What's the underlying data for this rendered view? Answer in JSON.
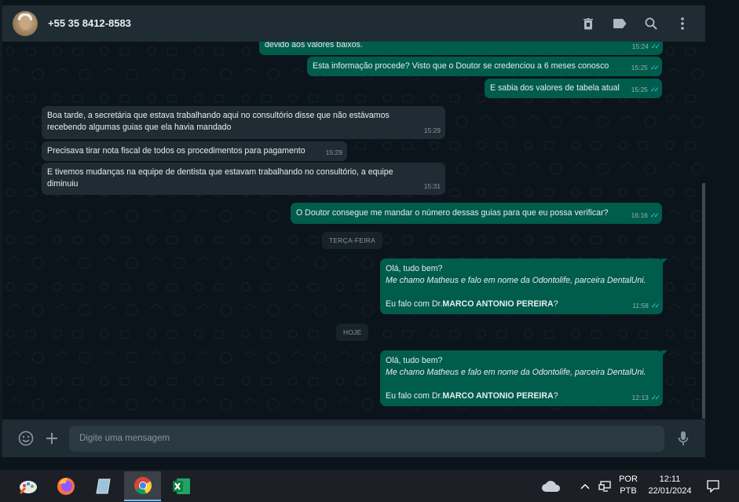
{
  "header": {
    "contact_name": "+55 35 8412-8583",
    "icons": [
      "delete-icon",
      "label-icon",
      "search-icon",
      "menu-icon"
    ]
  },
  "messages": {
    "m1": {
      "text": "devido aos valores baixos.",
      "time": "15:24"
    },
    "m2": {
      "text": "Esta informação procede? Visto que o Doutor se credenciou a 6 meses conosco",
      "time": "15:25"
    },
    "m3": {
      "text": "E sabia dos valores de tabela atual",
      "time": "15:25"
    },
    "m4": {
      "line1": "Boa tarde, a secretária que estava trabalhando aqui no consultório disse que não estávamos",
      "line2": "recebendo algumas guias que ela havia mandado",
      "time": "15:29"
    },
    "m5": {
      "text": "Precisava tirar nota fiscal de todos os procedimentos para pagamento",
      "time": "15:29"
    },
    "m6": {
      "line1": "E tivemos mudanças na equipe de dentista que estavam trabalhando no consultório, a equipe",
      "line2": "diminuiu",
      "time": "15:31"
    },
    "m7": {
      "text": "O Doutor consegue me mandar o número dessas guias para que eu possa verificar?",
      "time": "16:16"
    },
    "date1": "TERÇA-FEIRA",
    "m8": {
      "line1": "Olá, tudo bem?",
      "line2": "Me chamo Matheus e falo em nome da Odontolife, parceira DentalUni.",
      "line3_prefix": "Eu falo com Dr.",
      "line3_name": "MARCO ANTONIO PEREIRA",
      "line3_suffix": "?",
      "time": "11:58"
    },
    "date2": "HOJE",
    "m9": {
      "line1": "Olá, tudo bem?",
      "line2": "Me chamo Matheus e falo em nome da Odontolife, parceira DentalUni.",
      "line3_prefix": "Eu falo com Dr.",
      "line3_name": "MARCO ANTONIO PEREIRA",
      "line3_suffix": "?",
      "time": "12:13"
    }
  },
  "compose": {
    "placeholder": "Digite uma mensagem"
  },
  "taskbar": {
    "apps": [
      "paint-icon",
      "firefox-icon",
      "notepad-icon",
      "chrome-icon",
      "excel-icon"
    ],
    "lang_line1": "POR",
    "lang_line2": "PTB",
    "time": "12:11",
    "date": "22/01/2024"
  },
  "colors": {
    "outgoing_bubble": "#005c4b",
    "incoming_bubble": "#202c33",
    "read_ticks": "#53bdeb",
    "header_bg": "#202c33"
  }
}
